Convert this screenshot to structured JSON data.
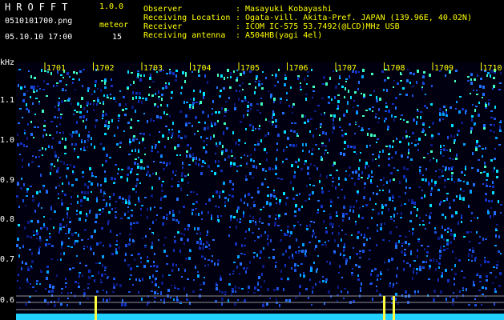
{
  "header": {
    "app_title": "HROFFT",
    "app_version": "1.0.0",
    "filename": "0510101700.png",
    "datetime": "05.10.10 17:00",
    "meteor_label": "meteor",
    "meteor_count": "15",
    "fields": [
      {
        "label": "Observer",
        "sep": ":",
        "value": "Masayuki Kobayashi"
      },
      {
        "label": "Receiving Location",
        "sep": ":",
        "value": "Ogata-vill. Akita-Pref. JAPAN (139.96E, 40.02N)"
      },
      {
        "label": "Receiver",
        "sep": ":",
        "value": "ICOM IC-575 53.7492(@LCD)MHz USB"
      },
      {
        "label": "Receiving antenna",
        "sep": ":",
        "value": "A504HB(yagi 4el)"
      }
    ]
  },
  "axes": {
    "y_unit": "kHz",
    "y_ticks": [
      "1.1",
      "1.0",
      "0.9",
      "0.8",
      "0.7",
      "0.6"
    ],
    "x_ticks": [
      "1701",
      "1702",
      "1703",
      "1704",
      "1705",
      "1706",
      "1707",
      "1708",
      "1709",
      "1710"
    ]
  },
  "colors": {
    "background": "#000000",
    "label_yellow": "#ffff00",
    "spectrum_blue": "#1030c0",
    "spectrum_cyan": "#00e0ff",
    "meteor_yellow": "#ffff40"
  }
}
